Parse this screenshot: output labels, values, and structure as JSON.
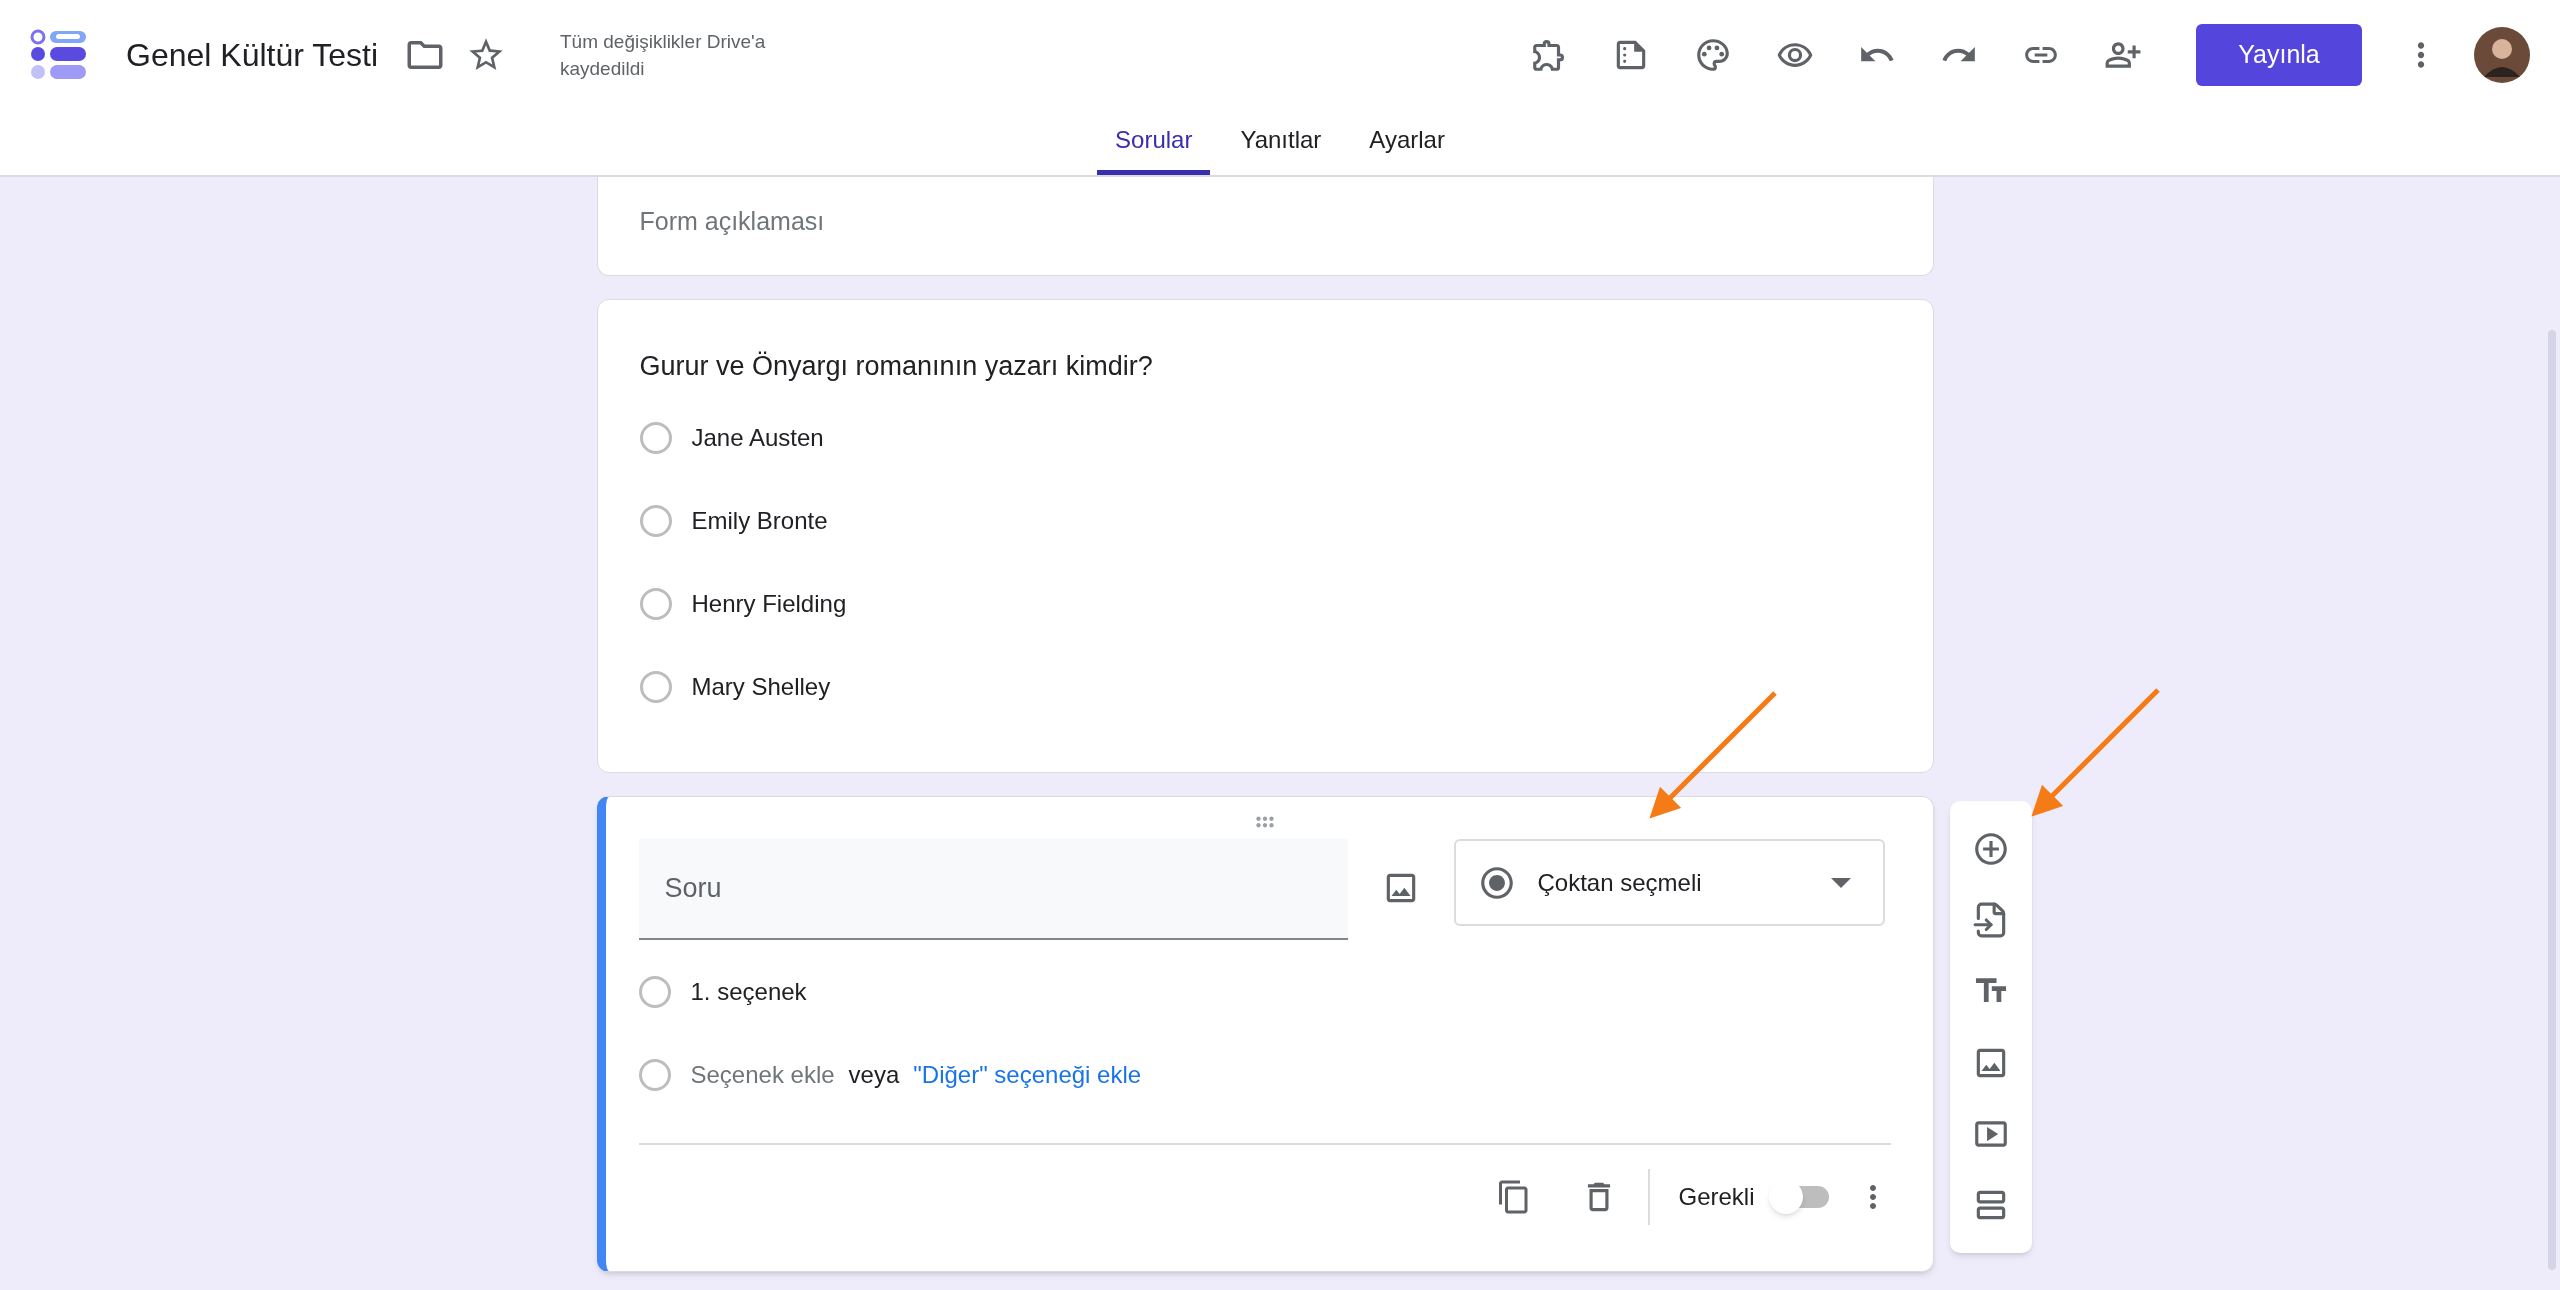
{
  "header": {
    "title": "Genel Kültür Testi",
    "save_status": "Tüm değişiklikler Drive'a kaydedildi",
    "publish_button": "Yayınla"
  },
  "tabs": [
    {
      "label": "Sorular",
      "selected": true
    },
    {
      "label": "Yanıtlar",
      "selected": false
    },
    {
      "label": "Ayarlar",
      "selected": false
    }
  ],
  "description_card": {
    "placeholder": "Form açıklaması"
  },
  "question_card": {
    "question": "Gurur ve Önyargı romanının yazarı kimdir?",
    "options": [
      {
        "label": "Jane Austen",
        "selected": false
      },
      {
        "label": "Emily Bronte",
        "selected": false
      },
      {
        "label": "Henry Fielding",
        "selected": false
      },
      {
        "label": "Mary Shelley",
        "selected": false
      }
    ]
  },
  "editor_card": {
    "question_placeholder": "Soru",
    "question_type": "Çoktan seçmeli",
    "options": [
      {
        "label": "1. seçenek",
        "selected": false
      }
    ],
    "add_option": "Seçenek ekle",
    "add_option_selected": false,
    "or": "veya",
    "add_other": "\"Diğer\" seçeneği ekle",
    "required_label": "Gerekli",
    "required": false
  }
}
